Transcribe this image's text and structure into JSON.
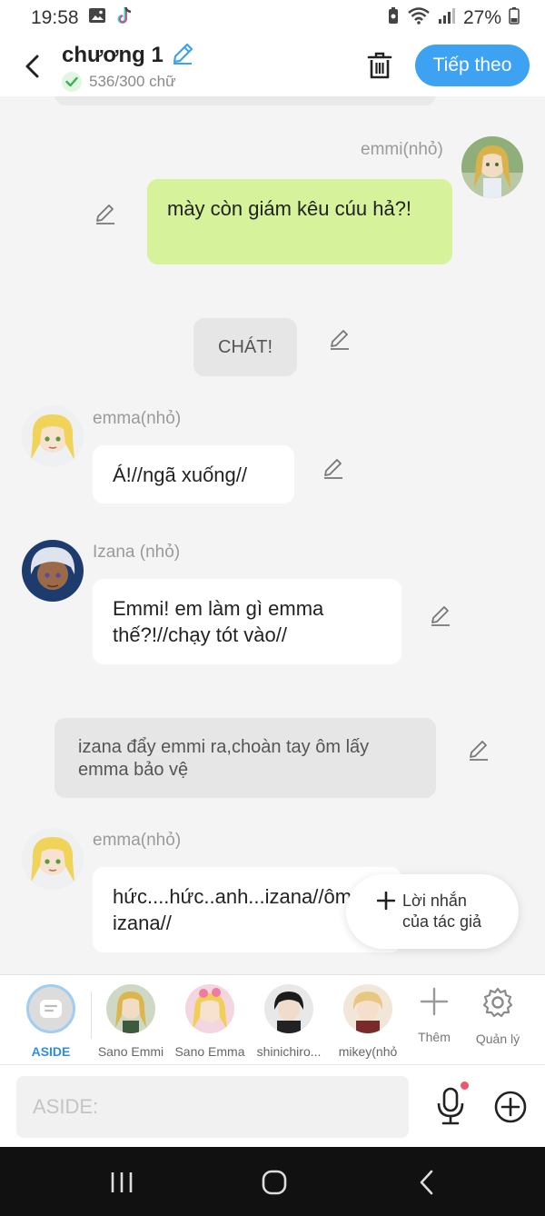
{
  "status_bar": {
    "time": "19:58",
    "battery": "27%",
    "left_icons": [
      "gallery-icon",
      "tiktok-icon"
    ],
    "right_icons": [
      "battery-saver-icon",
      "wifi-icon",
      "signal-icon",
      "battery-icon"
    ]
  },
  "header": {
    "title": "chương 1",
    "word_count": "536/300 chữ",
    "next_label": "Tiếp theo"
  },
  "messages": [
    {
      "sender": "emmi(nhỏ)",
      "text": "mày còn giám kêu cúu hả?!",
      "side": "right",
      "style": "green"
    },
    {
      "sender": "",
      "text": "CHÁT!",
      "side": "center",
      "style": "gray"
    },
    {
      "sender": "emma(nhỏ)",
      "text": "Á!//ngã xuống//",
      "side": "left",
      "style": "white"
    },
    {
      "sender": "Izana (nhỏ)",
      "text": "Emmi! em làm gì emma thế?!//chạy tót vào//",
      "side": "left",
      "style": "white"
    },
    {
      "sender": "",
      "text": "izana đẩy emmi ra,choàn tay ôm lấy emma bảo vệ",
      "side": "center",
      "style": "gray"
    },
    {
      "sender": "emma(nhỏ)",
      "text": "hức....hức..anh...izana//ôm izana//",
      "side": "left",
      "style": "white"
    }
  ],
  "author_note_label": "Lời nhắn của tác giả",
  "characters": [
    {
      "label": "ASIDE",
      "selected": true
    },
    {
      "label": "Sano Emmi",
      "selected": false
    },
    {
      "label": "Sano Emma",
      "selected": false
    },
    {
      "label": "shinichiro...",
      "selected": false
    },
    {
      "label": "mikey(nhỏ",
      "selected": false
    }
  ],
  "tools": {
    "add_label": "Thêm",
    "manage_label": "Quản lý"
  },
  "input": {
    "placeholder": "ASIDE:"
  },
  "colors": {
    "accent": "#3da2f2",
    "green_bubble": "#d6f29a",
    "aside_label": "#2f8fe0",
    "mic_badge": "#f0556b"
  }
}
